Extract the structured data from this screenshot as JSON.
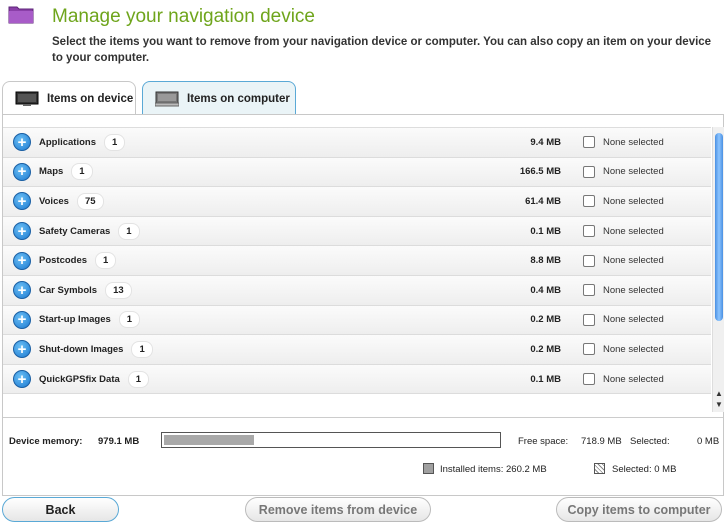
{
  "header": {
    "title": "Manage your navigation device",
    "subtitle": "Select the items you want to remove from your navigation device or computer. You can also copy an item on your device to your computer."
  },
  "tabs": [
    {
      "label": "Items on device",
      "active": true
    },
    {
      "label": "Items on computer",
      "active": false
    }
  ],
  "items": [
    {
      "name": "Applications",
      "count": "1",
      "size": "9.4 MB",
      "selection": "None selected"
    },
    {
      "name": "Maps",
      "count": "1",
      "size": "166.5 MB",
      "selection": "None selected"
    },
    {
      "name": "Voices",
      "count": "75",
      "size": "61.4 MB",
      "selection": "None selected"
    },
    {
      "name": "Safety Cameras",
      "count": "1",
      "size": "0.1 MB",
      "selection": "None selected"
    },
    {
      "name": "Postcodes",
      "count": "1",
      "size": "8.8 MB",
      "selection": "None selected"
    },
    {
      "name": "Car Symbols",
      "count": "13",
      "size": "0.4 MB",
      "selection": "None selected"
    },
    {
      "name": "Start-up Images",
      "count": "1",
      "size": "0.2 MB",
      "selection": "None selected"
    },
    {
      "name": "Shut-down Images",
      "count": "1",
      "size": "0.2 MB",
      "selection": "None selected"
    },
    {
      "name": "QuickGPSfix Data",
      "count": "1",
      "size": "0.1 MB",
      "selection": "None selected"
    }
  ],
  "memory": {
    "label": "Device memory:",
    "value": "979.1 MB",
    "installed_fraction": 0.27,
    "free_label": "Free space:",
    "free_value": "718.9 MB",
    "selected_label": "Selected:",
    "selected_value": "0 MB",
    "legend_installed": "Installed items: 260.2 MB",
    "legend_selected": "Selected: 0 MB"
  },
  "buttons": {
    "back": "Back",
    "remove": "Remove items from device",
    "copy": "Copy items to computer"
  },
  "colors": {
    "title": "#6fa51c",
    "accent": "#5aa9d6",
    "plus": "#1a78d0",
    "folder": "#8a3fa8"
  }
}
